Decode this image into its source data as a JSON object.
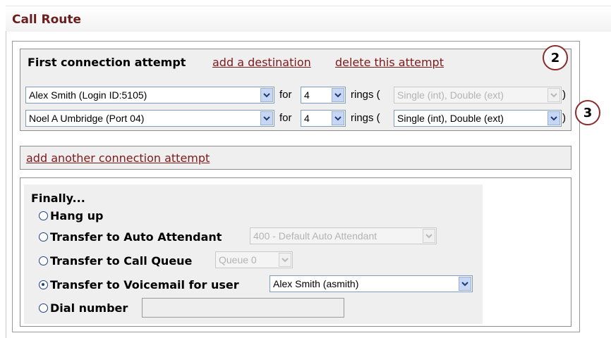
{
  "title": "Call Route",
  "attempt": {
    "heading": "First connection attempt",
    "add_destination": "add a destination",
    "delete_attempt": "delete this attempt",
    "rows": [
      {
        "destination": "Alex Smith (Login ID:5105)",
        "for_label": "for",
        "rings_value": "4",
        "rings_label": "rings (",
        "ring_type": "Single (int), Double (ext)",
        "close": ")"
      },
      {
        "destination": "Noel A Umbridge (Port 04)",
        "for_label": "for",
        "rings_value": "4",
        "rings_label": "rings (",
        "ring_type": "Single (int), Double (ext)",
        "close": ")"
      }
    ]
  },
  "markers": {
    "m2": "2",
    "m3": "3"
  },
  "add_attempt": "add another connection attempt",
  "finally": {
    "heading": "Finally...",
    "options": [
      {
        "label": "Hang up",
        "checked": false
      },
      {
        "label": "Transfer to Auto Attendant",
        "checked": false,
        "select": "400 - Default Auto Attendant"
      },
      {
        "label": "Transfer to Call Queue",
        "checked": false,
        "select": "Queue 0"
      },
      {
        "label": "Transfer to Voicemail for user",
        "checked": true,
        "select": "Alex Smith (asmith)"
      },
      {
        "label": "Dial number",
        "checked": false,
        "input_value": ""
      }
    ]
  }
}
